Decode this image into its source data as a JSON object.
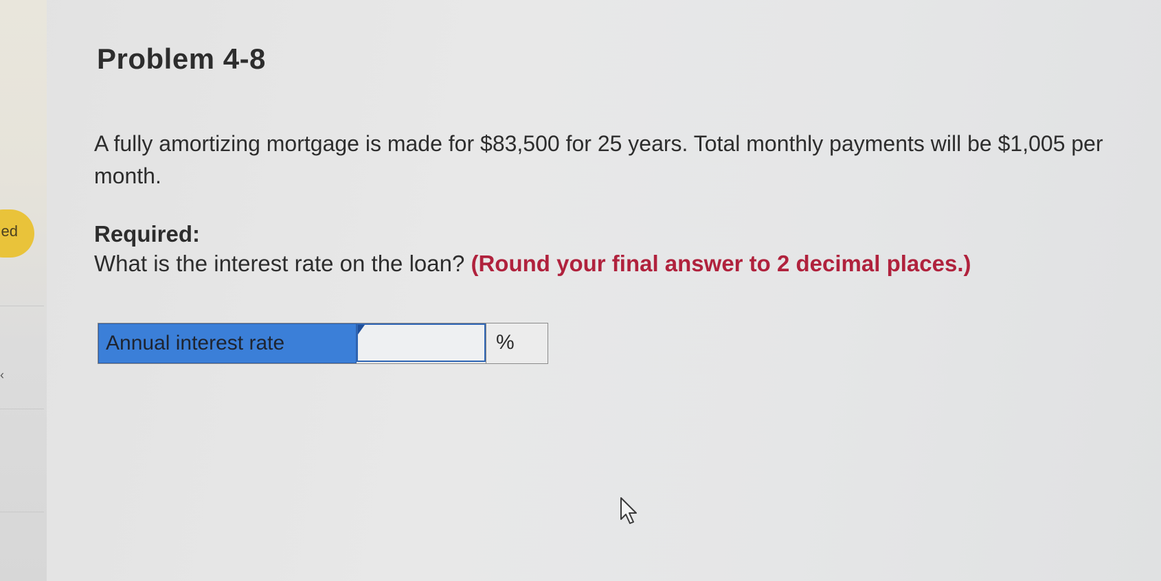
{
  "problem": {
    "title": "Problem 4-8",
    "text": "A fully amortizing mortgage is made for $83,500 for 25 years. Total monthly payments will be $1,005 per month.",
    "required_label": "Required:",
    "question": "What is the interest rate on the loan?",
    "instruction": "(Round your final answer to 2 decimal places.)"
  },
  "answer": {
    "label": "Annual interest rate",
    "value": "",
    "unit": "%"
  },
  "sidebar": {
    "badge_text": "ed",
    "chevron": "‹"
  },
  "colors": {
    "label_background": "#3b7fd8",
    "instruction_text": "#b0223d",
    "badge": "#e9c33a"
  }
}
